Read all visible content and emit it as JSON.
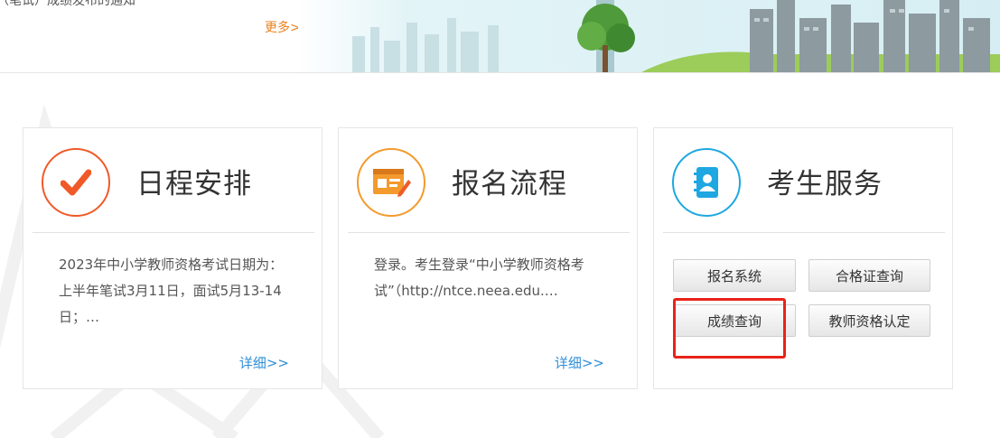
{
  "notice": {
    "text": "（笔试）成绩发布的通知",
    "more_label": "更多>>"
  },
  "cards": [
    {
      "title": "日程安排",
      "icon": "checkmark-icon",
      "accent": "#f05a28",
      "desc": "2023年中小学教师资格考试日期为：上半年笔试3月11日，面试5月13-14日；…",
      "detail_label": "详细>>"
    },
    {
      "title": "报名流程",
      "icon": "form-edit-icon",
      "accent": "#f39a2c",
      "desc": "登录。考生登录“中小学教师资格考试”（http://ntce.neea.edu.…",
      "detail_label": "详细>>"
    },
    {
      "title": "考生服务",
      "icon": "contact-book-icon",
      "accent": "#1ea7e1",
      "buttons": [
        "报名系统",
        "合格证查询",
        "成绩查询",
        "教师资格认定"
      ]
    }
  ],
  "colors": {
    "link": "#2f8fd8",
    "more": "#e8821e",
    "highlight": "#e8231a"
  }
}
